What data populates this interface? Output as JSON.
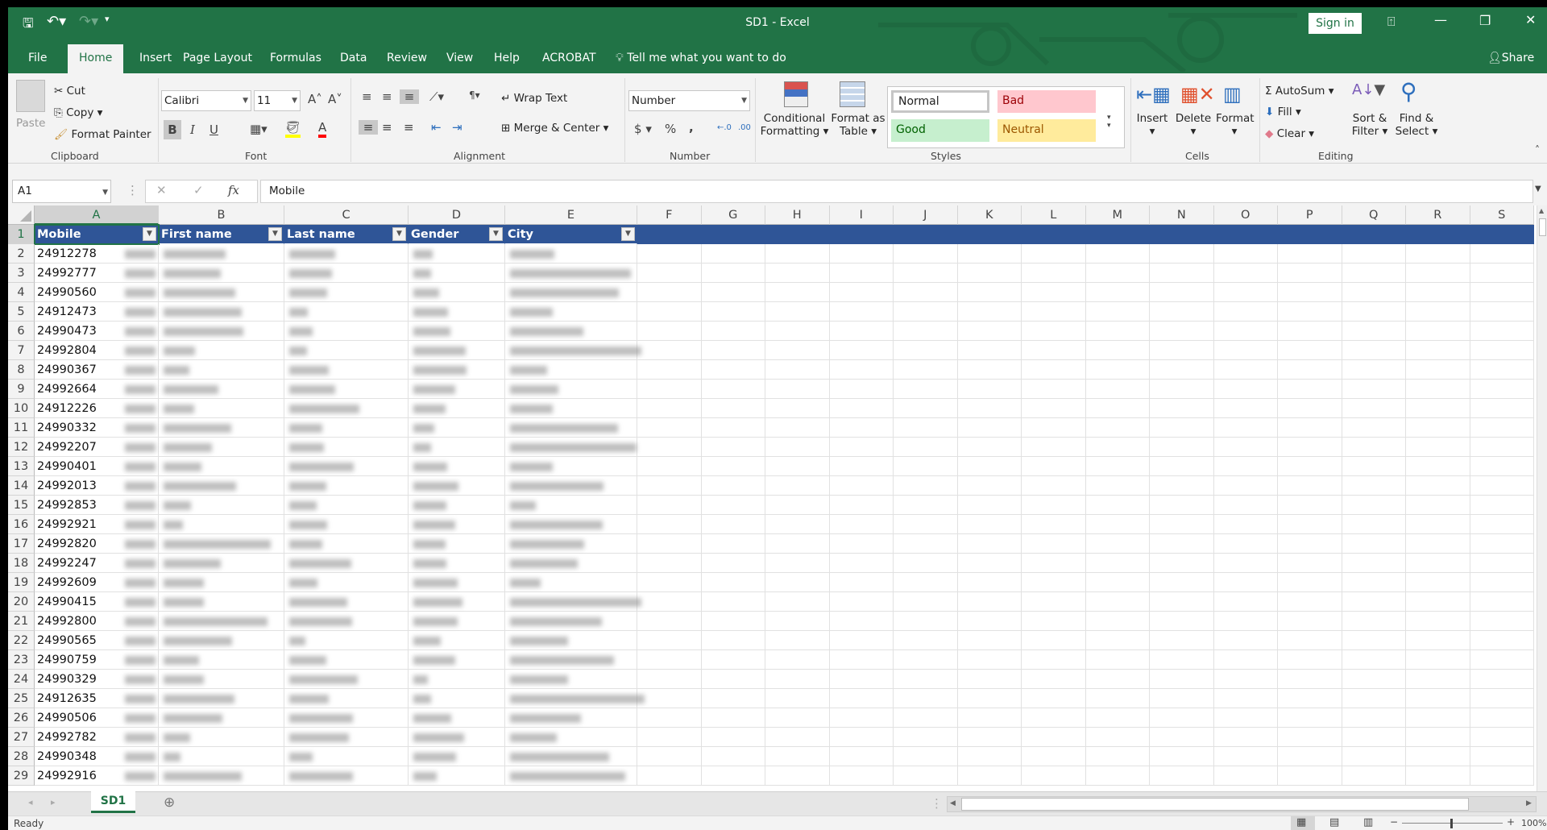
{
  "window": {
    "title": "SD1  -  Excel",
    "sign_in": "Sign in",
    "share": "Share"
  },
  "tabs": [
    "File",
    "Home",
    "Insert",
    "Page Layout",
    "Formulas",
    "Data",
    "Review",
    "View",
    "Help",
    "ACROBAT"
  ],
  "active_tab": "Home",
  "tell_me": "Tell me what you want to do",
  "ribbon": {
    "clipboard": {
      "label": "Clipboard",
      "paste": "Paste",
      "cut": "Cut",
      "copy": "Copy",
      "format_painter": "Format Painter"
    },
    "font": {
      "label": "Font",
      "font_name": "Calibri",
      "font_size": "11",
      "bold": "B",
      "italic": "I",
      "underline": "U",
      "fill_color": "#ffff00",
      "font_color": "#ff0000"
    },
    "alignment": {
      "label": "Alignment",
      "wrap_text": "Wrap Text",
      "merge_center": "Merge & Center"
    },
    "number": {
      "label": "Number",
      "format": "Number",
      "currency": "$",
      "percent": "%",
      "comma": ","
    },
    "styles": {
      "label": "Styles",
      "conditional_formatting_1": "Conditional",
      "conditional_formatting_2": "Formatting",
      "format_as_table_1": "Format as",
      "format_as_table_2": "Table",
      "normal": "Normal",
      "bad": "Bad",
      "good": "Good",
      "neutral": "Neutral"
    },
    "cells": {
      "label": "Cells",
      "insert": "Insert",
      "delete": "Delete",
      "format": "Format"
    },
    "editing": {
      "label": "Editing",
      "autosum": "AutoSum",
      "fill": "Fill",
      "clear": "Clear",
      "sort_filter_1": "Sort &",
      "sort_filter_2": "Filter",
      "find_select_1": "Find &",
      "find_select_2": "Select"
    }
  },
  "formula_bar": {
    "name_box": "A1",
    "fx": "fx",
    "content": "Mobile"
  },
  "columns": [
    "A",
    "B",
    "C",
    "D",
    "E",
    "F",
    "G",
    "H",
    "I",
    "J",
    "K",
    "L",
    "M",
    "N",
    "O",
    "P",
    "Q",
    "R",
    "S"
  ],
  "headers": [
    "Mobile",
    "First name",
    "Last name",
    "Gender",
    "City"
  ],
  "mobile_partial": [
    "24912278",
    "24992777",
    "24990560",
    "24912473",
    "24990473",
    "24992804",
    "24990367",
    "24992664",
    "24912226",
    "24990332",
    "24992207",
    "24990401",
    "24992013",
    "24992853",
    "24992921",
    "24992820",
    "24992247",
    "24992609",
    "24990415",
    "24992800",
    "24990565",
    "24990759",
    "24990329",
    "24912635",
    "24990506",
    "24992782",
    "24990348",
    "24992916"
  ],
  "selected_cell": "A1",
  "header_fill": "#2f5597",
  "sheet_tabs": [
    "SD1"
  ],
  "status": {
    "text": "Ready",
    "zoom": "100%"
  },
  "theme": {
    "accent": "#217346"
  }
}
